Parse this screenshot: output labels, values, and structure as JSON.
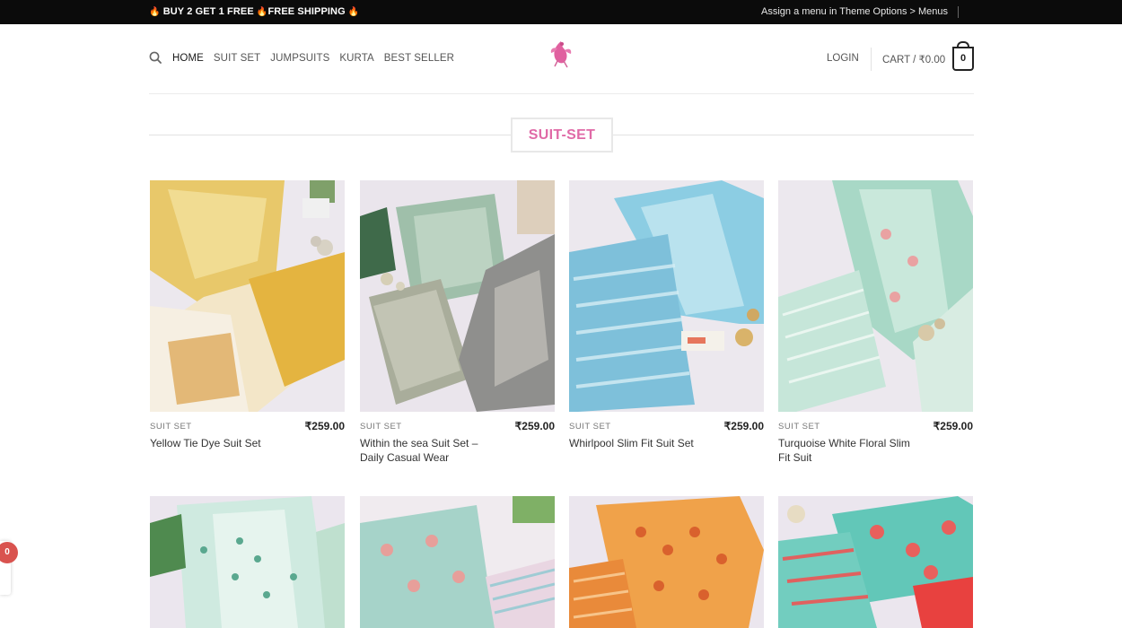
{
  "topbar": {
    "promo": "BUY 2 GET 1 FREE",
    "promo2": "FREE SHIPPING",
    "menu_note": "Assign a menu in Theme Options > Menus"
  },
  "nav": {
    "items": [
      "HOME",
      "SUIT SET",
      "JUMPSUITS",
      "KURTA",
      "BEST SELLER"
    ]
  },
  "account": {
    "login": "LOGIN",
    "cart_label": "CART / ₹0.00",
    "cart_count": "0"
  },
  "section": {
    "title": "SUIT-SET"
  },
  "products": [
    {
      "category": "SUIT SET",
      "name": "Yellow Tie Dye Suit Set",
      "price": "₹259.00"
    },
    {
      "category": "SUIT SET",
      "name": "Within the sea Suit Set – Daily Casual Wear",
      "price": "₹259.00"
    },
    {
      "category": "SUIT SET",
      "name": "Whirlpool Slim Fit Suit Set",
      "price": "₹259.00"
    },
    {
      "category": "SUIT SET",
      "name": "Turquoise White Floral Slim Fit Suit",
      "price": "₹259.00"
    }
  ],
  "floating_badge": "0",
  "colors": {
    "accent": "#e06aa7",
    "topbar": "#0b0b0b",
    "badge": "#d9534f"
  }
}
